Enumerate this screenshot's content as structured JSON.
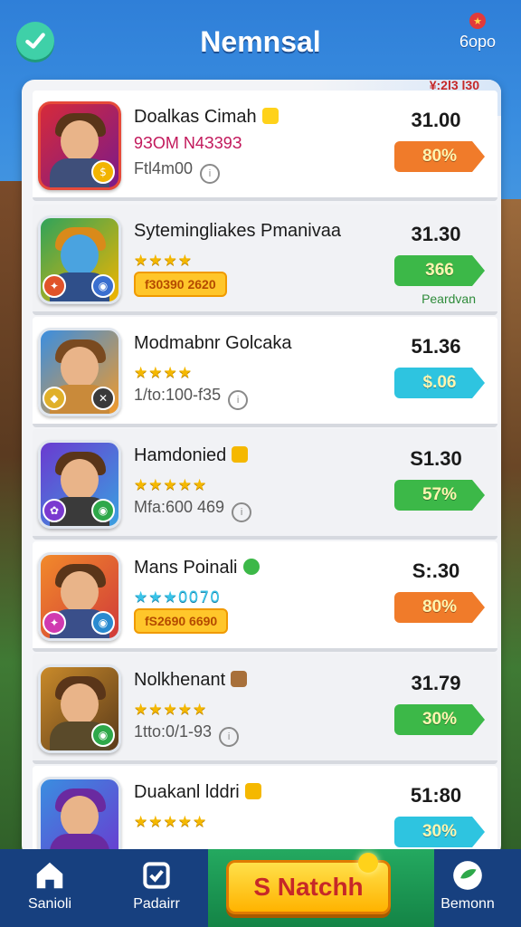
{
  "header": {
    "title": "Nemnsal",
    "corner_label": "6opo",
    "corner_badge": "★",
    "panel_note": "¥:2l3 l30"
  },
  "rows": [
    {
      "name": "Doalkas Cimah",
      "stars": "",
      "sub": "9ЗOM N4З39З",
      "sub2": "Ftl4m00",
      "price": "31.00",
      "tag": "80%",
      "tag_color": "#f07b2a",
      "tag_note": ""
    },
    {
      "name": "Sytemingliakes Pmanivaa",
      "stars": "★★★★",
      "pill": "f30390 2620",
      "price": "31.30",
      "tag": "366",
      "tag_color": "#3cb848",
      "tag_note": "Peardvan"
    },
    {
      "name": "Modmabnr Golcaka",
      "stars": "★★★★",
      "sub": "1/to:100-f35",
      "price": "51.36",
      "tag": "$.06",
      "tag_color": "#2ec4e0",
      "tag_note": ""
    },
    {
      "name": "Hamdonied",
      "stars": "★★★★★",
      "sub": "Mfa:600 469",
      "price": "S1.30",
      "tag": "57%",
      "tag_color": "#3cb848",
      "tag_note": ""
    },
    {
      "name": "Mans Poinali",
      "stars": "★★★0070",
      "pill": "fS2690 6690",
      "price": "S:.30",
      "tag": "80%",
      "tag_color": "#f07b2a",
      "tag_note": ""
    },
    {
      "name": "Nolkhenant",
      "stars": "★★★★★",
      "sub": "1tto:0/1-93",
      "price": "31.79",
      "tag": "30%",
      "tag_color": "#3cb848",
      "tag_note": ""
    },
    {
      "name": "Duakanl lddri",
      "stars": "★★★★★",
      "sub": "",
      "price": "51:80",
      "tag": "30%",
      "tag_color": "#2ec4e0",
      "tag_note": ""
    }
  ],
  "nav": {
    "home_label": "Sanioli",
    "badge_label": "Padairr",
    "cta_label": "S Natchh",
    "right_label": "Bemonn"
  },
  "colors": {
    "header_bg": "#2f7fd8",
    "nav_bg": "#17407f",
    "cta_bg": "#ffc62a",
    "tag_green": "#3cb848",
    "tag_orange": "#f07b2a",
    "tag_cyan": "#2ec4e0"
  }
}
